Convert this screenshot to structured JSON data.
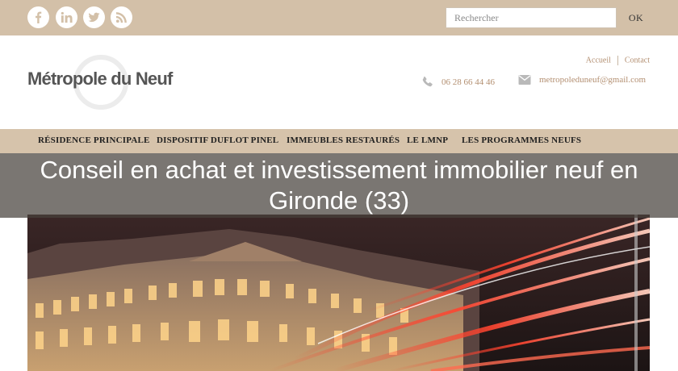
{
  "social": {
    "icons": [
      "facebook-icon",
      "linkedin-icon",
      "twitter-icon",
      "rss-icon"
    ]
  },
  "search": {
    "placeholder": "Rechercher",
    "button_label": "OK"
  },
  "header": {
    "logo_text": "Métropole du Neuf",
    "links": {
      "home": "Accueil",
      "contact": "Contact"
    },
    "phone": "06 28 66 44 46",
    "email": "metropoleduneuf@gmail.com"
  },
  "nav": {
    "items": [
      {
        "label": "RÉSIDENCE PRINCIPALE"
      },
      {
        "label": "DISPOSITIF DUFLOT PINEL"
      },
      {
        "label": "IMMEUBLES RESTAURÉS"
      },
      {
        "label": "LE LMNP"
      },
      {
        "label": "LES PROGRAMMES NEUFS"
      }
    ]
  },
  "banner": {
    "title": "Conseil en achat et investissement immobilier neuf en Gironde (33)"
  },
  "colors": {
    "topbar": "#d3c0a8",
    "nav": "#d6c3ab",
    "accent_text": "#b38f71",
    "overlay": "rgba(70,65,60,0.72)"
  }
}
